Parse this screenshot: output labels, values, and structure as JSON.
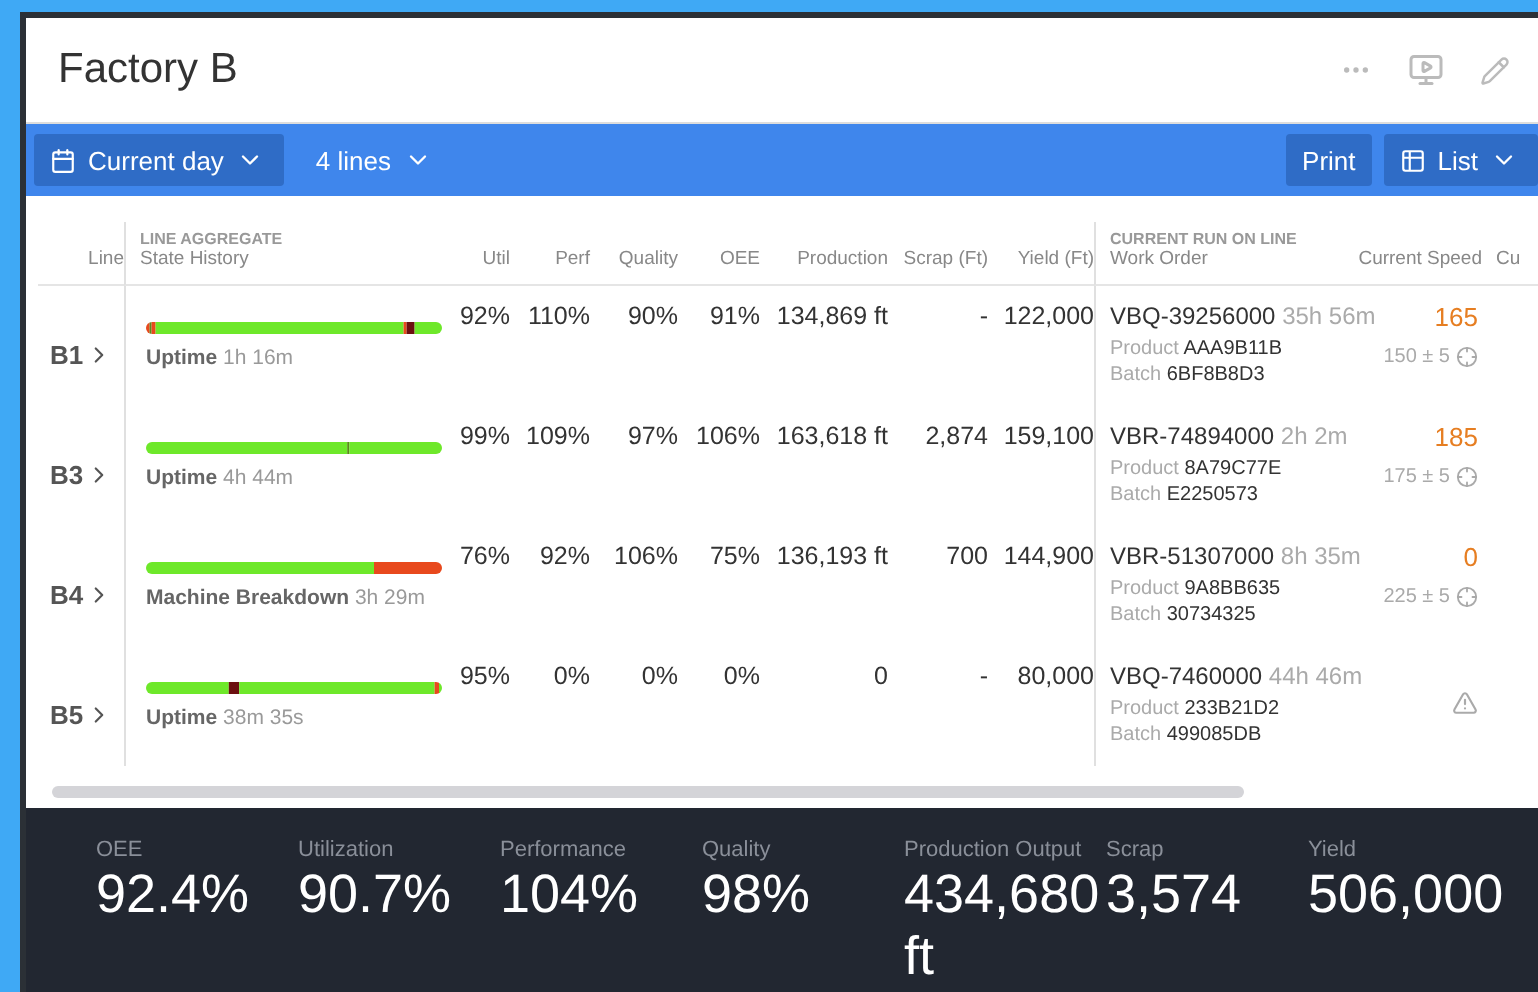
{
  "title": "Factory B",
  "toolbar": {
    "date_range": "Current day",
    "lines": "4 lines",
    "print": "Print",
    "view": "List"
  },
  "table": {
    "group_headers": {
      "aggregate": "LINE AGGREGATE",
      "current_run": "CURRENT RUN ON LINE"
    },
    "columns": [
      "Line",
      "State History",
      "Util",
      "Perf",
      "Quality",
      "OEE",
      "Production",
      "Scrap (Ft)",
      "Yield (Ft)",
      "Work Order",
      "Current Speed",
      "Cu"
    ],
    "rows": [
      {
        "line": "B1",
        "state": "Uptime",
        "duration": "1h 16m",
        "util": "92%",
        "perf": "110%",
        "quality": "90%",
        "oee": "91%",
        "production": "134,869 ft",
        "scrap": "-",
        "yield": "122,000",
        "work_order": "VBQ-39256000",
        "run_time": "35h 56m",
        "product_label": "Product",
        "product": "AAA9B11B",
        "batch_label": "Batch",
        "batch": "6BF8B8D3",
        "speed": "165",
        "target": "150 ± 5"
      },
      {
        "line": "B3",
        "state": "Uptime",
        "duration": "4h 44m",
        "util": "99%",
        "perf": "109%",
        "quality": "97%",
        "oee": "106%",
        "production": "163,618 ft",
        "scrap": "2,874",
        "yield": "159,100",
        "work_order": "VBR-74894000",
        "run_time": "2h 2m",
        "product_label": "Product",
        "product": "8A79C77E",
        "batch_label": "Batch",
        "batch": "E2250573",
        "speed": "185",
        "target": "175 ± 5"
      },
      {
        "line": "B4",
        "state": "Machine Breakdown",
        "duration": "3h 29m",
        "util": "76%",
        "perf": "92%",
        "quality": "106%",
        "oee": "75%",
        "production": "136,193 ft",
        "scrap": "700",
        "yield": "144,900",
        "work_order": "VBR-51307000",
        "run_time": "8h 35m",
        "product_label": "Product",
        "product": "9A8BB635",
        "batch_label": "Batch",
        "batch": "30734325",
        "speed": "0",
        "target": "225 ± 5"
      },
      {
        "line": "B5",
        "state": "Uptime",
        "duration": "38m 35s",
        "util": "95%",
        "perf": "0%",
        "quality": "0%",
        "oee": "0%",
        "production": "0",
        "scrap": "-",
        "yield": "80,000",
        "work_order": "VBQ-7460000",
        "run_time": "44h 46m",
        "product_label": "Product",
        "product": "233B21D2",
        "batch_label": "Batch",
        "batch": "499085DB",
        "speed_warning": true
      }
    ]
  },
  "summary": [
    {
      "label": "OEE",
      "value": "92.4%"
    },
    {
      "label": "Utilization",
      "value": "90.7%"
    },
    {
      "label": "Performance",
      "value": "104%"
    },
    {
      "label": "Quality",
      "value": "98%"
    },
    {
      "label": "Production Output",
      "value": "434,680 ft"
    },
    {
      "label": "Scrap",
      "value": "3,574"
    },
    {
      "label": "Yield",
      "value": "506,000"
    }
  ]
}
